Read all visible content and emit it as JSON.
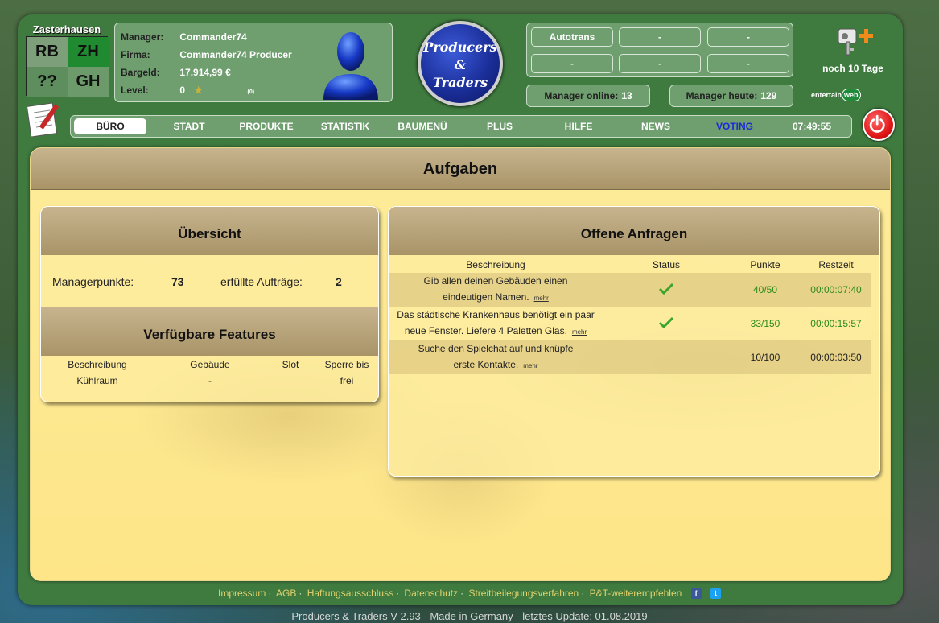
{
  "city": {
    "name": "Zasterhausen",
    "cells": [
      "RB",
      "ZH",
      "??",
      "GH"
    ]
  },
  "manager": {
    "labels": {
      "manager": "Manager:",
      "firma": "Firma:",
      "bargeld": "Bargeld:",
      "level": "Level:"
    },
    "name": "Commander74",
    "firma": "Commander74 Producer",
    "bargeld": "17.914,99 €",
    "level": "0",
    "level_extra": "(0)"
  },
  "logo": {
    "line1": "Producers",
    "line2": "&",
    "line3": "Traders"
  },
  "autotrans": {
    "cells": [
      "Autotrans",
      "-",
      "-",
      "-",
      "-",
      "-"
    ]
  },
  "stats": {
    "online_label": "Manager online:",
    "online_value": "13",
    "today_label": "Manager heute:",
    "today_value": "129"
  },
  "days_left": "noch 10 Tage",
  "entertain": {
    "text": "entertain",
    "badge": "web"
  },
  "nav": {
    "items": [
      "BÜRO",
      "STADT",
      "PRODUKTE",
      "STATISTIK",
      "BAUMENÜ",
      "PLUS",
      "HILFE",
      "NEWS",
      "VOTING"
    ],
    "clock": "07:49:55"
  },
  "page": {
    "title": "Aufgaben"
  },
  "overview": {
    "title": "Übersicht",
    "points_label": "Managerpunkte:",
    "points_value": "73",
    "orders_label": "erfüllte Aufträge:",
    "orders_value": "2"
  },
  "features": {
    "title": "Verfügbare Features",
    "headers": [
      "Beschreibung",
      "Gebäude",
      "Slot",
      "Sperre bis"
    ],
    "rows": [
      {
        "beschreibung": "Kühlraum",
        "gebaeude": "-",
        "slot": "",
        "sperre": "frei"
      }
    ]
  },
  "requests": {
    "title": "Offene Anfragen",
    "headers": [
      "Beschreibung",
      "Status",
      "Punkte",
      "Restzeit"
    ],
    "more": "mehr",
    "rows": [
      {
        "line1": "Gib allen deinen Gebäuden einen",
        "line2": "eindeutigen Namen.",
        "status": "check",
        "punkte": "40/50",
        "restzeit": "00:00:07:40"
      },
      {
        "line1": "Das städtische Krankenhaus benötigt ein paar",
        "line2": "neue Fenster. Liefere 4 Paletten Glas.",
        "status": "check",
        "punkte": "33/150",
        "restzeit": "00:00:15:57"
      },
      {
        "line1": "Suche den Spielchat auf und knüpfe",
        "line2": "erste Kontakte.",
        "status": "",
        "punkte": "10/100",
        "restzeit": "00:00:03:50"
      }
    ]
  },
  "footer": {
    "links": [
      "Impressum",
      "AGB",
      "Haftungsausschluss",
      "Datenschutz",
      "Streitbeilegungsverfahren",
      "P&T-weiterempfehlen"
    ],
    "version": "Producers & Traders V 2.93 - Made in Germany - letztes Update: 01.08.2019"
  },
  "colors": {
    "accent_green": "#6f9e6f",
    "status_green": "#2b8a1d",
    "content_yellow": "#fde98f"
  }
}
